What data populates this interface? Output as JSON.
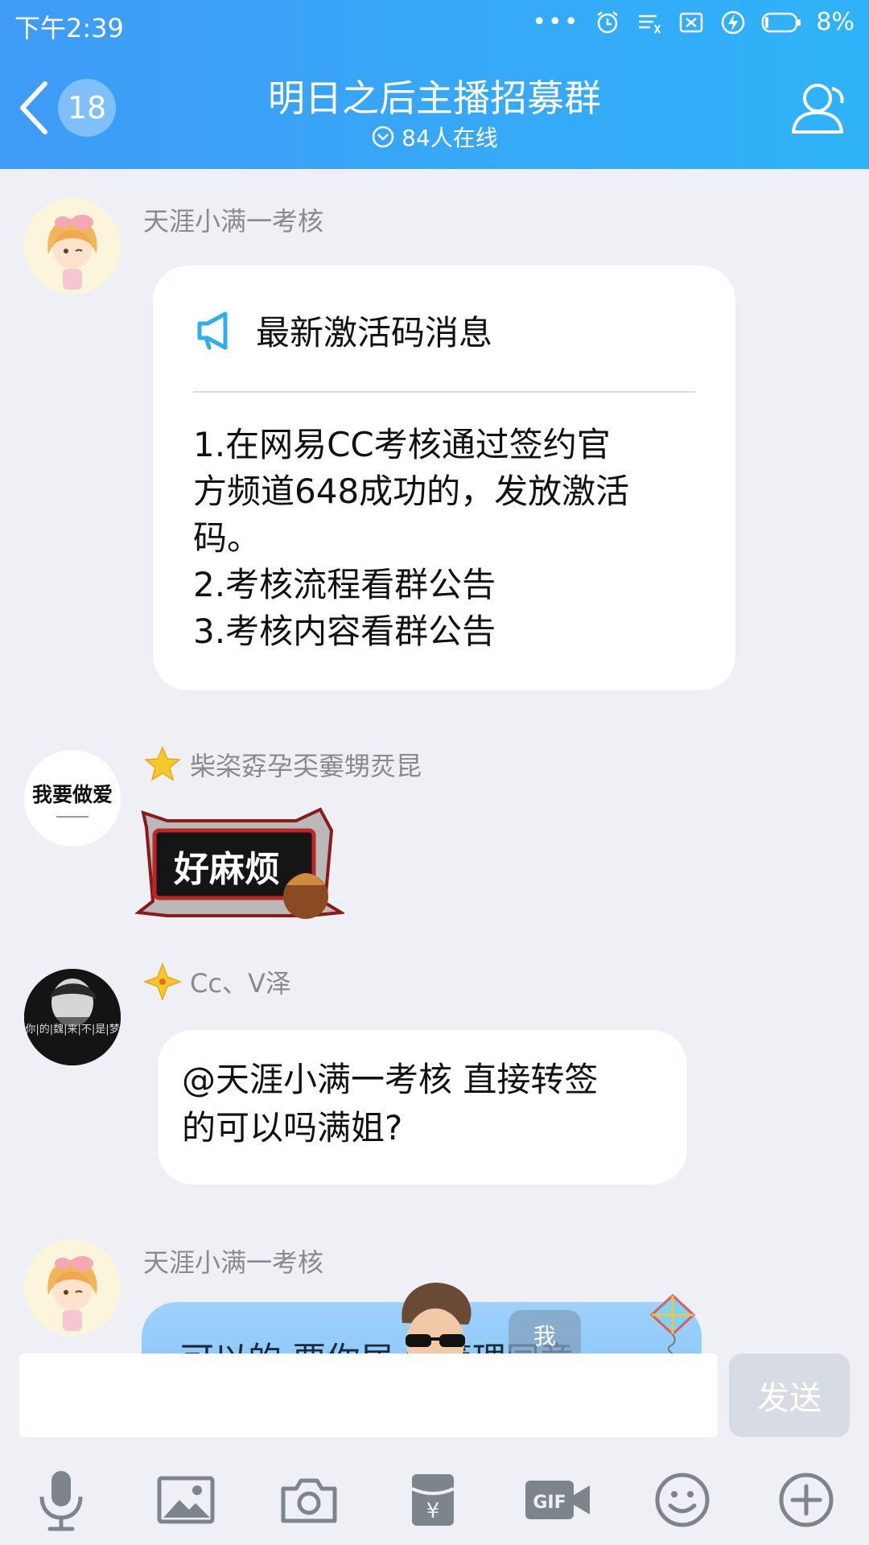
{
  "status_bar": {
    "time": "下午2:39",
    "more": "•••",
    "battery_percent": "8%"
  },
  "header": {
    "unread_count": "18",
    "title": "明日之后主播招募群",
    "online": "84人在线"
  },
  "messages": [
    {
      "sender": "天涯小满一考核",
      "notice_title": "最新激活码消息",
      "notice_body": "1.在网易CC考核通过签约官\n方频道648成功的，发放激活\n码。\n2.考核流程看群公告\n3.考核内容看群公告"
    },
    {
      "sender": "柴栥孬孕奀嫑甥烎昆",
      "avatar_text": "我要做爱",
      "sticker_text": "好麻烦"
    },
    {
      "sender": "Cc、V泽",
      "avatar_text": "你|的|魏|来|不|是|梦",
      "text": "@天涯小满一考核 直接转签\n的可以吗满姐?"
    },
    {
      "sender": "天涯小满一考核",
      "text": "可以的 要你居 给管理同意",
      "me_badge": "我"
    }
  ],
  "input": {
    "placeholder": "",
    "send_label": "发送"
  },
  "colors": {
    "header_start": "#3f9bf6",
    "header_end": "#2fb3f8",
    "chat_bg": "#eef0f6",
    "bubble": "#ffffff",
    "notice_icon": "#2eaeea"
  },
  "toolbar_icons": [
    "microphone-icon",
    "image-icon",
    "camera-icon",
    "red-packet-icon",
    "gif-icon",
    "emoji-icon",
    "plus-icon"
  ]
}
